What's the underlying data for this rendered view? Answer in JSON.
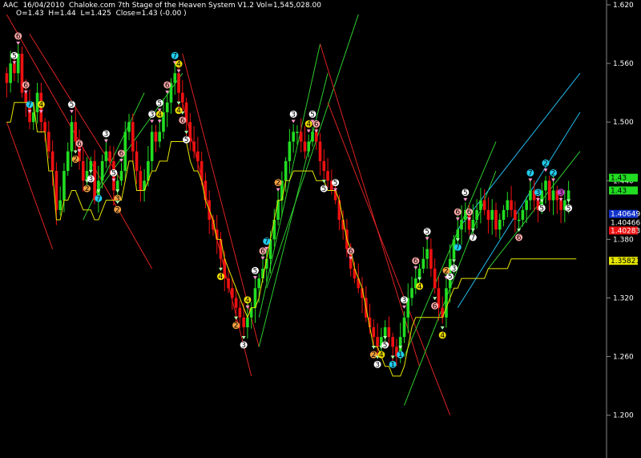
{
  "header": {
    "symbol": "AAC",
    "date": "16/04/2010",
    "system": "Chaloke.com 7th Stage of the Heaven System V1.2",
    "volume": "Vol=1,545,028.00",
    "open": "O=1.43",
    "high": "H=1.44",
    "low": "L=1.425",
    "close": "Close=1.43 (-0.00 )"
  },
  "colors": {
    "background": "#000000",
    "bull": "#22dd22",
    "bear": "#ee1111",
    "trailing_stop": "#e6e600",
    "channel_up": "#2ecc2e",
    "channel_down": "#dd2222",
    "channel_cyan": "#22bbee",
    "axis_text": "#ffffff"
  },
  "chart_data": {
    "type": "candlestick",
    "ylim": [
      1.18,
      1.62
    ],
    "yticks": [
      1.2,
      1.26,
      1.32,
      1.38,
      1.44,
      1.5,
      1.56,
      1.62
    ],
    "ytick_labels": [
      "1.200",
      "1.260",
      "1.320",
      "1.380",
      "1.440",
      "1.500",
      "1.560",
      "1.620"
    ],
    "grid": false,
    "price_tags": [
      {
        "value": 1.443,
        "label": "1.43",
        "bg": "#22dd22",
        "fg": "#000000"
      },
      {
        "value": 1.43,
        "label": "1.43",
        "bg": "#22dd22",
        "fg": "#000000"
      },
      {
        "value": 1.406,
        "label": "1.40649",
        "bg": "#1133cc",
        "fg": "#ffffff"
      },
      {
        "value": 1.397,
        "label": "1.40466",
        "bg": "#000000",
        "fg": "#ffffff"
      },
      {
        "value": 1.389,
        "label": "1.40283",
        "bg": "#ee1111",
        "fg": "#ffffff"
      },
      {
        "value": 1.358,
        "label": "1.35821",
        "bg": "#e6e600",
        "fg": "#000000"
      }
    ],
    "closes": [
      1.54,
      1.56,
      1.55,
      1.57,
      1.53,
      1.52,
      1.5,
      1.51,
      1.53,
      1.5,
      1.49,
      1.47,
      1.45,
      1.41,
      1.42,
      1.45,
      1.47,
      1.5,
      1.48,
      1.46,
      1.44,
      1.45,
      1.46,
      1.42,
      1.44,
      1.46,
      1.47,
      1.46,
      1.43,
      1.44,
      1.45,
      1.49,
      1.5,
      1.47,
      1.45,
      1.43,
      1.44,
      1.46,
      1.49,
      1.48,
      1.49,
      1.51,
      1.52,
      1.54,
      1.55,
      1.53,
      1.52,
      1.5,
      1.48,
      1.47,
      1.46,
      1.44,
      1.42,
      1.4,
      1.39,
      1.38,
      1.36,
      1.34,
      1.33,
      1.32,
      1.31,
      1.3,
      1.29,
      1.3,
      1.31,
      1.33,
      1.34,
      1.35,
      1.36,
      1.38,
      1.4,
      1.42,
      1.44,
      1.46,
      1.48,
      1.49,
      1.49,
      1.48,
      1.47,
      1.48,
      1.49,
      1.48,
      1.46,
      1.45,
      1.44,
      1.43,
      1.42,
      1.4,
      1.39,
      1.37,
      1.35,
      1.34,
      1.33,
      1.32,
      1.3,
      1.29,
      1.28,
      1.27,
      1.28,
      1.29,
      1.28,
      1.27,
      1.26,
      1.28,
      1.3,
      1.32,
      1.33,
      1.34,
      1.35,
      1.36,
      1.37,
      1.35,
      1.33,
      1.31,
      1.3,
      1.33,
      1.36,
      1.38,
      1.39,
      1.4,
      1.41,
      1.39,
      1.4,
      1.41,
      1.42,
      1.41,
      1.4,
      1.41,
      1.39,
      1.4,
      1.41,
      1.42,
      1.41,
      1.4,
      1.4,
      1.41,
      1.42,
      1.43,
      1.42,
      1.41,
      1.43,
      1.44,
      1.42,
      1.43,
      1.42,
      1.41,
      1.42,
      1.43
    ],
    "trailing_stop": [
      1.5,
      1.5,
      1.52,
      1.52,
      1.52,
      1.52,
      1.52,
      1.52,
      1.49,
      1.49,
      1.49,
      1.45,
      1.45,
      1.4,
      1.4,
      1.42,
      1.42,
      1.43,
      1.43,
      1.42,
      1.41,
      1.41,
      1.41,
      1.4,
      1.4,
      1.41,
      1.42,
      1.42,
      1.42,
      1.42,
      1.42,
      1.44,
      1.46,
      1.46,
      1.43,
      1.43,
      1.43,
      1.44,
      1.45,
      1.45,
      1.46,
      1.46,
      1.46,
      1.48,
      1.48,
      1.48,
      1.48,
      1.48,
      1.46,
      1.45,
      1.45,
      1.44,
      1.42,
      1.41,
      1.4,
      1.38,
      1.38,
      1.36,
      1.35,
      1.34,
      1.33,
      1.32,
      1.31,
      1.3,
      1.31,
      1.31,
      1.32,
      1.34,
      1.36,
      1.38,
      1.4,
      1.42,
      1.42,
      1.44,
      1.44,
      1.45,
      1.45,
      1.45,
      1.45,
      1.45,
      1.45,
      1.44,
      1.44,
      1.44,
      1.43,
      1.43,
      1.43,
      1.42,
      1.4,
      1.38,
      1.37,
      1.35,
      1.34,
      1.33,
      1.31,
      1.29,
      1.27,
      1.27,
      1.26,
      1.25,
      1.25,
      1.24,
      1.24,
      1.24,
      1.25,
      1.27,
      1.29,
      1.3,
      1.3,
      1.3,
      1.3,
      1.3,
      1.3,
      1.3,
      1.3,
      1.31,
      1.32,
      1.33,
      1.33,
      1.34,
      1.34,
      1.34,
      1.34,
      1.34,
      1.34,
      1.34,
      1.35,
      1.35,
      1.35,
      1.35,
      1.35,
      1.35,
      1.36,
      1.36,
      1.36,
      1.36,
      1.36,
      1.36,
      1.36,
      1.36,
      1.36,
      1.36,
      1.36,
      1.36,
      1.36,
      1.36,
      1.36,
      1.36,
      1.36,
      1.36
    ],
    "channels": [
      {
        "color": "#dd2222",
        "from": [
          0,
          1.61
        ],
        "to": [
          38,
          1.35
        ]
      },
      {
        "color": "#dd2222",
        "from": [
          0,
          1.5
        ],
        "to": [
          12,
          1.37
        ]
      },
      {
        "color": "#dd2222",
        "from": [
          6,
          1.59
        ],
        "to": [
          30,
          1.44
        ]
      },
      {
        "color": "#2ecc2e",
        "from": [
          20,
          1.4
        ],
        "to": [
          36,
          1.53
        ]
      },
      {
        "color": "#2ecc2e",
        "from": [
          24,
          1.43
        ],
        "to": [
          46,
          1.55
        ]
      },
      {
        "color": "#dd2222",
        "from": [
          46,
          1.57
        ],
        "to": [
          66,
          1.27
        ]
      },
      {
        "color": "#dd2222",
        "from": [
          46,
          1.52
        ],
        "to": [
          64,
          1.24
        ]
      },
      {
        "color": "#2ecc2e",
        "from": [
          66,
          1.3
        ],
        "to": [
          82,
          1.58
        ]
      },
      {
        "color": "#2ecc2e",
        "from": [
          66,
          1.27
        ],
        "to": [
          84,
          1.55
        ]
      },
      {
        "color": "#2ecc2e",
        "from": [
          68,
          1.33
        ],
        "to": [
          92,
          1.61
        ]
      },
      {
        "color": "#dd2222",
        "from": [
          82,
          1.58
        ],
        "to": [
          108,
          1.25
        ]
      },
      {
        "color": "#dd2222",
        "from": [
          84,
          1.52
        ],
        "to": [
          116,
          1.2
        ]
      },
      {
        "color": "#2ecc2e",
        "from": [
          104,
          1.21
        ],
        "to": [
          128,
          1.45
        ]
      },
      {
        "color": "#2ecc2e",
        "from": [
          104,
          1.26
        ],
        "to": [
          128,
          1.48
        ]
      },
      {
        "color": "#22bbee",
        "from": [
          118,
          1.39
        ],
        "to": [
          150,
          1.55
        ]
      },
      {
        "color": "#22bbee",
        "from": [
          118,
          1.31
        ],
        "to": [
          150,
          1.51
        ]
      },
      {
        "color": "#2ecc2e",
        "from": [
          126,
          1.35
        ],
        "to": [
          150,
          1.47
        ]
      }
    ],
    "markers": [
      {
        "i": 2,
        "label": "5",
        "color": "#ffffff",
        "pos": "above"
      },
      {
        "i": 3,
        "label": "6",
        "color": "#ffaaaa",
        "pos": "above"
      },
      {
        "i": 5,
        "label": "6",
        "color": "#ffaaaa",
        "pos": "above"
      },
      {
        "i": 6,
        "label": "7",
        "color": "#22ccee",
        "pos": "above"
      },
      {
        "i": 9,
        "label": "4",
        "color": "#eedd00",
        "pos": "above"
      },
      {
        "i": 17,
        "label": "5",
        "color": "#ffffff",
        "pos": "above"
      },
      {
        "i": 19,
        "label": "6",
        "color": "#ffaaaa",
        "pos": "above"
      },
      {
        "i": 18,
        "label": "2",
        "color": "#f0a040",
        "pos": "below"
      },
      {
        "i": 21,
        "label": "2",
        "color": "#f0a040",
        "pos": "below"
      },
      {
        "i": 22,
        "label": "3",
        "color": "#ffffff",
        "pos": "below"
      },
      {
        "i": 24,
        "label": "7",
        "color": "#22ccee",
        "pos": "below"
      },
      {
        "i": 26,
        "label": "3",
        "color": "#ffffff",
        "pos": "above"
      },
      {
        "i": 28,
        "label": "5",
        "color": "#ffffff",
        "pos": "above"
      },
      {
        "i": 30,
        "label": "6",
        "color": "#ffaaaa",
        "pos": "above"
      },
      {
        "i": 29,
        "label": "3",
        "color": "#f0a040",
        "pos": "below"
      },
      {
        "i": 29,
        "label": "2",
        "color": "#f0a040",
        "pos": "below2"
      },
      {
        "i": 38,
        "label": "3",
        "color": "#ffffff",
        "pos": "above"
      },
      {
        "i": 40,
        "label": "4",
        "color": "#eedd00",
        "pos": "above"
      },
      {
        "i": 40,
        "label": "5",
        "color": "#ffffff",
        "pos": "above2"
      },
      {
        "i": 42,
        "label": "6",
        "color": "#ffaaaa",
        "pos": "above"
      },
      {
        "i": 44,
        "label": "7",
        "color": "#22ccee",
        "pos": "above"
      },
      {
        "i": 45,
        "label": "4",
        "color": "#eedd00",
        "pos": "above2"
      },
      {
        "i": 46,
        "label": "6",
        "color": "#ffaaaa",
        "pos": "below"
      },
      {
        "i": 47,
        "label": "5",
        "color": "#ffffff",
        "pos": "below"
      },
      {
        "i": 45,
        "label": "4",
        "color": "#eedd00",
        "pos": "below"
      },
      {
        "i": 56,
        "label": "4",
        "color": "#eedd00",
        "pos": "below"
      },
      {
        "i": 60,
        "label": "2",
        "color": "#f0a040",
        "pos": "below"
      },
      {
        "i": 62,
        "label": "3",
        "color": "#ffffff",
        "pos": "below"
      },
      {
        "i": 63,
        "label": "4",
        "color": "#eedd00",
        "pos": "above"
      },
      {
        "i": 65,
        "label": "5",
        "color": "#ffffff",
        "pos": "above"
      },
      {
        "i": 67,
        "label": "6",
        "color": "#ffaaaa",
        "pos": "above"
      },
      {
        "i": 68,
        "label": "7",
        "color": "#22ccee",
        "pos": "above"
      },
      {
        "i": 71,
        "label": "2",
        "color": "#f0a040",
        "pos": "above"
      },
      {
        "i": 75,
        "label": "3",
        "color": "#ffffff",
        "pos": "above"
      },
      {
        "i": 79,
        "label": "4",
        "color": "#eedd00",
        "pos": "above"
      },
      {
        "i": 80,
        "label": "5",
        "color": "#ffffff",
        "pos": "above"
      },
      {
        "i": 81,
        "label": "6",
        "color": "#ffaaaa",
        "pos": "above"
      },
      {
        "i": 86,
        "label": "5",
        "color": "#ffffff",
        "pos": "above"
      },
      {
        "i": 83,
        "label": "5",
        "color": "#ffffff",
        "pos": "below"
      },
      {
        "i": 90,
        "label": "6",
        "color": "#ffaaaa",
        "pos": "above"
      },
      {
        "i": 96,
        "label": "2",
        "color": "#f0a040",
        "pos": "below"
      },
      {
        "i": 97,
        "label": "3",
        "color": "#ffffff",
        "pos": "below"
      },
      {
        "i": 98,
        "label": "4",
        "color": "#eedd00",
        "pos": "below"
      },
      {
        "i": 99,
        "label": "5",
        "color": "#ffffff",
        "pos": "below"
      },
      {
        "i": 101,
        "label": "1",
        "color": "#22ccee",
        "pos": "below"
      },
      {
        "i": 103,
        "label": "1",
        "color": "#22ccee",
        "pos": "below"
      },
      {
        "i": 104,
        "label": "3",
        "color": "#ffffff",
        "pos": "above"
      },
      {
        "i": 107,
        "label": "6",
        "color": "#ffaaaa",
        "pos": "above"
      },
      {
        "i": 108,
        "label": "4",
        "color": "#eedd00",
        "pos": "below"
      },
      {
        "i": 110,
        "label": "5",
        "color": "#ffffff",
        "pos": "above"
      },
      {
        "i": 112,
        "label": "6",
        "color": "#ffaaaa",
        "pos": "below"
      },
      {
        "i": 114,
        "label": "4",
        "color": "#eedd00",
        "pos": "below"
      },
      {
        "i": 115,
        "label": "2",
        "color": "#f0a040",
        "pos": "above"
      },
      {
        "i": 116,
        "label": "5",
        "color": "#ffffff",
        "pos": "below"
      },
      {
        "i": 117,
        "label": "3",
        "color": "#ffffff",
        "pos": "below2"
      },
      {
        "i": 118,
        "label": "6",
        "color": "#ffaaaa",
        "pos": "above"
      },
      {
        "i": 118,
        "label": "7",
        "color": "#22ccee",
        "pos": "below"
      },
      {
        "i": 120,
        "label": "5",
        "color": "#ffffff",
        "pos": "above"
      },
      {
        "i": 121,
        "label": "6",
        "color": "#ffaaaa",
        "pos": "above"
      },
      {
        "i": 122,
        "label": "7",
        "color": "#ffffff",
        "pos": "below"
      },
      {
        "i": 134,
        "label": "6",
        "color": "#ffaaaa",
        "pos": "below"
      },
      {
        "i": 137,
        "label": "7",
        "color": "#22ccee",
        "pos": "above"
      },
      {
        "i": 139,
        "label": "3",
        "color": "#22ccee",
        "pos": "above"
      },
      {
        "i": 141,
        "label": "2",
        "color": "#22ccee",
        "pos": "above"
      },
      {
        "i": 143,
        "label": "2",
        "color": "#22ccee",
        "pos": "above"
      },
      {
        "i": 145,
        "label": "3",
        "color": "#cc44cc",
        "pos": "above"
      },
      {
        "i": 140,
        "label": "5",
        "color": "#ffffff",
        "pos": "below"
      },
      {
        "i": 147,
        "label": "5",
        "color": "#ffffff",
        "pos": "below"
      }
    ]
  }
}
